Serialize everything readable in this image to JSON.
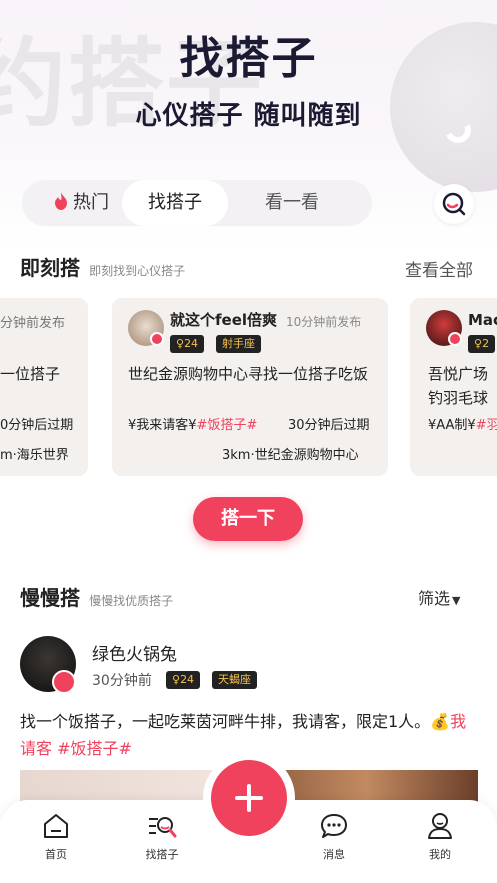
{
  "hero": {
    "bg_text": "约搭子",
    "title": "找搭子",
    "subtitle": "心仪搭子 随叫随到"
  },
  "tabs": [
    {
      "label": "热门",
      "icon": "flame-icon"
    },
    {
      "label": "找搭子",
      "selected": true
    },
    {
      "label": "看一看"
    }
  ],
  "instant": {
    "title": "即刻搭",
    "subtitle": "即刻找到心仪搭子",
    "view_all": "查看全部",
    "cards": [
      {
        "time": "分钟前发布",
        "text": "一位搭子",
        "expire": "0分钟后过期",
        "location": "m·海乐世界"
      },
      {
        "name": "就这个feel倍爽",
        "time": "10分钟前发布",
        "age": "24",
        "zodiac": "射手座",
        "text": "世纪金源购物中心寻找一位搭子吃饭",
        "pay": "¥我来请客¥",
        "tag": "#饭搭子#",
        "expire": "30分钟后过期",
        "location": "3km·世纪金源购物中心"
      },
      {
        "name": "Mac",
        "age": "2",
        "text": "吾悦广场钓羽毛球",
        "pay": "¥AA制¥",
        "tag": "#羽"
      }
    ]
  },
  "cta": "搭一下",
  "slow": {
    "title": "慢慢搭",
    "subtitle": "慢慢找优质搭子",
    "filter": "筛选",
    "post": {
      "name": "绿色火锅兔",
      "time": "30分钟前",
      "age": "24",
      "zodiac": "天蝎座",
      "text": "找一个饭搭子，一起吃莱茵河畔牛排，我请客，限定1人。",
      "pay": "我请客",
      "tag": "#饭搭子#"
    }
  },
  "tabbar": [
    {
      "label": "首页",
      "icon": "home-icon"
    },
    {
      "label": "找搭子",
      "icon": "find-partner-icon"
    },
    {
      "label": "消息",
      "icon": "message-icon"
    },
    {
      "label": "我的",
      "icon": "profile-icon"
    }
  ],
  "colors": {
    "accent": "#f0425d",
    "orange": "#f6a340",
    "dark": "#1c1a33"
  }
}
